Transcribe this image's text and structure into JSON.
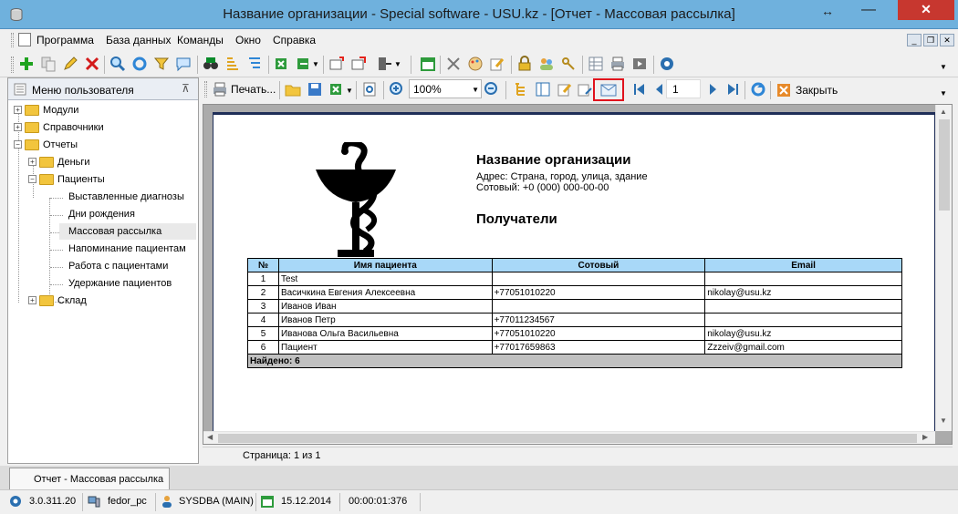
{
  "window": {
    "title": "Название организации - Special software - USU.kz - [Отчет - Массовая рассылка]",
    "resize_glyph": "↔",
    "minimize_glyph": "—",
    "close_glyph": "✕"
  },
  "menu": {
    "items": [
      "Программа",
      "База данных",
      "Команды",
      "Окно",
      "Справка"
    ],
    "mdi_buttons": [
      "_",
      "❐",
      "✕"
    ]
  },
  "sidebar": {
    "header": "Меню пользователя",
    "pin_glyph": "⊼",
    "tree": [
      {
        "label": "Модули",
        "expander": "+"
      },
      {
        "label": "Справочники",
        "expander": "+"
      },
      {
        "label": "Отчеты",
        "expander": "−"
      },
      {
        "label": "Деньги",
        "expander": "+"
      },
      {
        "label": "Пациенты",
        "expander": "−"
      },
      {
        "label": "Выставленные диагнозы"
      },
      {
        "label": "Дни рождения"
      },
      {
        "label": "Массовая рассылка",
        "selected": true
      },
      {
        "label": "Напоминание пациентам"
      },
      {
        "label": "Работа с пациентами"
      },
      {
        "label": "Удержание пациентов"
      },
      {
        "label": "Склад",
        "expander": "+"
      }
    ]
  },
  "report_toolbar": {
    "print_label": "Печать...",
    "zoom_value": "100%",
    "zoom_arrow": "▼",
    "page_value": "1",
    "close_label": "Закрыть"
  },
  "report": {
    "org_name": "Название организации",
    "address": "Адрес: Страна, город, улица, здание",
    "phone": "Сотовый: +0 (000) 000-00-00",
    "section_title": "Получатели",
    "columns": [
      "№",
      "Имя пациента",
      "Сотовый",
      "Email"
    ],
    "rows": [
      [
        "1",
        "Test",
        "",
        ""
      ],
      [
        "2",
        "Васичкина Евгения Алексеевна",
        "+77051010220",
        "nikolay@usu.kz"
      ],
      [
        "3",
        "Иванов Иван",
        "",
        ""
      ],
      [
        "4",
        "Иванов Петр",
        "+77011234567",
        ""
      ],
      [
        "5",
        "Иванова Ольга Васильевна",
        "+77051010220",
        "nikolay@usu.kz"
      ],
      [
        "6",
        "Пациент",
        "+77017659863",
        "Zzzeiv@gmail.com"
      ]
    ],
    "footer": "Найдено: 6"
  },
  "scroll_arrows": {
    "up": "▲",
    "down": "▼",
    "left": "◀",
    "right": "▶"
  },
  "page_status": "Страница: 1 из 1",
  "tab": {
    "label": "Отчет - Массовая рассылка"
  },
  "statusbar": {
    "version": "3.0.311.20",
    "computer": "fedor_pc",
    "user": "SYSDBA (MAIN)",
    "date": "15.12.2014",
    "timer": "00:00:01:376"
  },
  "colors": {
    "titlebar": "#6fb1dd",
    "close_button": "#c7372f",
    "highlight_frame": "#e0121d",
    "table_header": "#a8d8f8",
    "table_footer": "#c0c0c0",
    "page_frame": "#1f2e58"
  }
}
